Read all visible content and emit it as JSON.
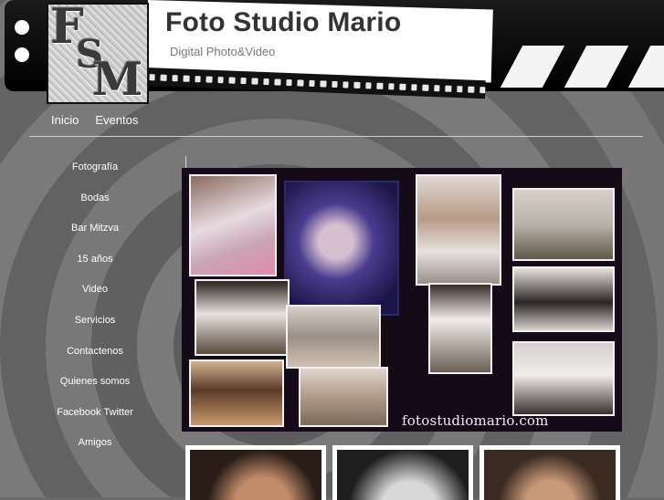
{
  "header": {
    "title": "Foto Studio Mario",
    "subtitle": "Digital Photo&Video",
    "logo_letters": [
      "F",
      "S",
      "M"
    ]
  },
  "topnav": {
    "items": [
      {
        "label": "Inicio"
      },
      {
        "label": "Eventos"
      }
    ]
  },
  "sidebar": {
    "items": [
      {
        "label": "Fotografía"
      },
      {
        "label": "Bodas"
      },
      {
        "label": "Bar Mitzva"
      },
      {
        "label": "15 años"
      },
      {
        "label": "Video"
      },
      {
        "label": "Servicios"
      },
      {
        "label": "Contactenos"
      },
      {
        "label": "Quienes somos"
      },
      {
        "label": "Facebook Twitter"
      },
      {
        "label": "Amigos"
      }
    ]
  },
  "collage": {
    "watermark": "fotostudiomario.com"
  },
  "colors": {
    "background": "#6a6a6a",
    "header_black": "#000000",
    "text_light": "#ffffff",
    "title_text": "#333333"
  }
}
